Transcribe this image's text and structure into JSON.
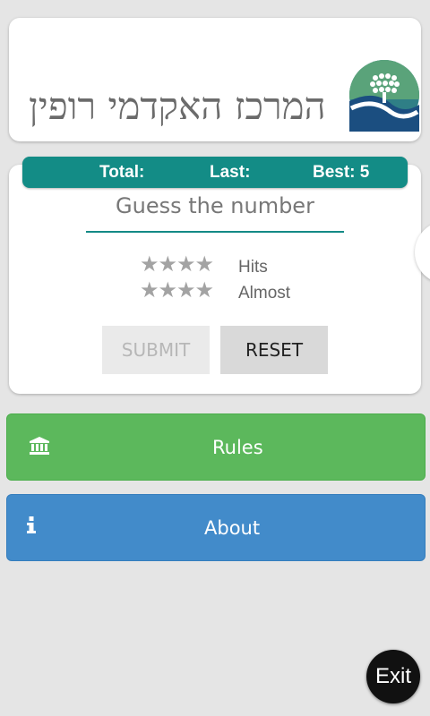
{
  "header": {
    "title": "המרכז האקדמי רופין",
    "logo_icon": "ruppin-logo"
  },
  "scoreboard": {
    "total_label": "Total:",
    "last_label": "Last:",
    "best_label": "Best: 5"
  },
  "game": {
    "guess_placeholder": "Guess the number",
    "hits_label": "Hits",
    "almost_label": "Almost",
    "hits_stars": "★★★★",
    "almost_stars": "★★★★",
    "submit_label": "SUBMIT",
    "reset_label": "RESET"
  },
  "menu": {
    "rules": {
      "label": "Rules",
      "icon": "institution-icon"
    },
    "about": {
      "label": "About",
      "icon": "info-icon"
    }
  },
  "exit": {
    "label": "Exit"
  },
  "colors": {
    "teal": "#138c86",
    "green": "#5cb85c",
    "blue": "#428bca"
  }
}
